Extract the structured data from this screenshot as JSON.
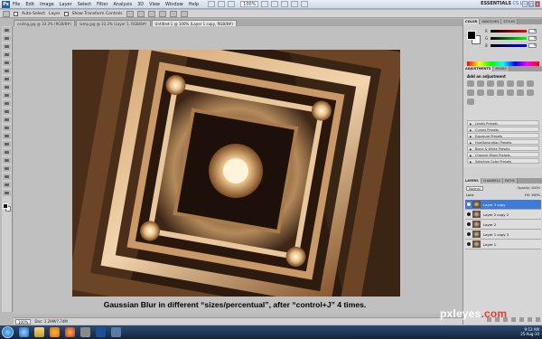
{
  "app": {
    "menus": [
      "File",
      "Edit",
      "Image",
      "Layer",
      "Select",
      "Filter",
      "Analysis",
      "3D",
      "View",
      "Window",
      "Help"
    ],
    "zoom": "100%",
    "workspace": "ESSENTIALS",
    "cs_live": "CS Live"
  },
  "options_bar": {
    "auto_select_label": "Auto-Select",
    "auto_select_value": "Layer",
    "transform_label": "Show Transform Controls"
  },
  "tabs": [
    {
      "label": "ceiling.jpg @ 33.3% (RGB/8#)"
    },
    {
      "label": "lamp.jpg @ 33.3% (Layer 1, RGB/8#)"
    },
    {
      "label": "Untitled-1 @ 100% (Layer 1 copy, RGB/8#)"
    }
  ],
  "canvas": {
    "caption": "Gaussian Blur in different “sizes/percentual”, after “control+J” 4 times."
  },
  "status": {
    "zoom": "100%",
    "doc": "Doc: 1.29M/7.74M"
  },
  "color_panel": {
    "tabs": [
      "COLOR",
      "SWATCHES",
      "STYLES"
    ],
    "sliders": [
      {
        "label": "R",
        "value": "0",
        "color": "#d23a3a"
      },
      {
        "label": "G",
        "value": "0",
        "color": "#3ab23a"
      },
      {
        "label": "B",
        "value": "0",
        "color": "#3a5ad2"
      }
    ]
  },
  "adjustments_panel": {
    "tabs": [
      "ADJUSTMENTS",
      "MASKS"
    ],
    "title": "Add an adjustment",
    "presets": [
      "Levels Presets",
      "Curves Presets",
      "Exposure Presets",
      "Hue/Saturation Presets",
      "Black & White Presets",
      "Channel Mixer Presets",
      "Selective Color Presets"
    ]
  },
  "layers_panel": {
    "tabs": [
      "LAYERS",
      "CHANNELS",
      "PATHS"
    ],
    "blend_mode": "Normal",
    "opacity": "Opacity: 100%",
    "lock_label": "Lock:",
    "fill": "Fill: 100%",
    "layers": [
      {
        "name": "Layer 3 copy",
        "selected": true
      },
      {
        "name": "Layer 2 copy 2",
        "selected": false
      },
      {
        "name": "Layer 2",
        "selected": false
      },
      {
        "name": "Layer 1 copy 3",
        "selected": false
      },
      {
        "name": "Layer 1",
        "selected": false
      }
    ]
  },
  "taskbar": {
    "time": "9:12 AM",
    "date": "25-Aug-10"
  },
  "watermark": {
    "text": "pxleyes",
    "suffix": ".com"
  }
}
